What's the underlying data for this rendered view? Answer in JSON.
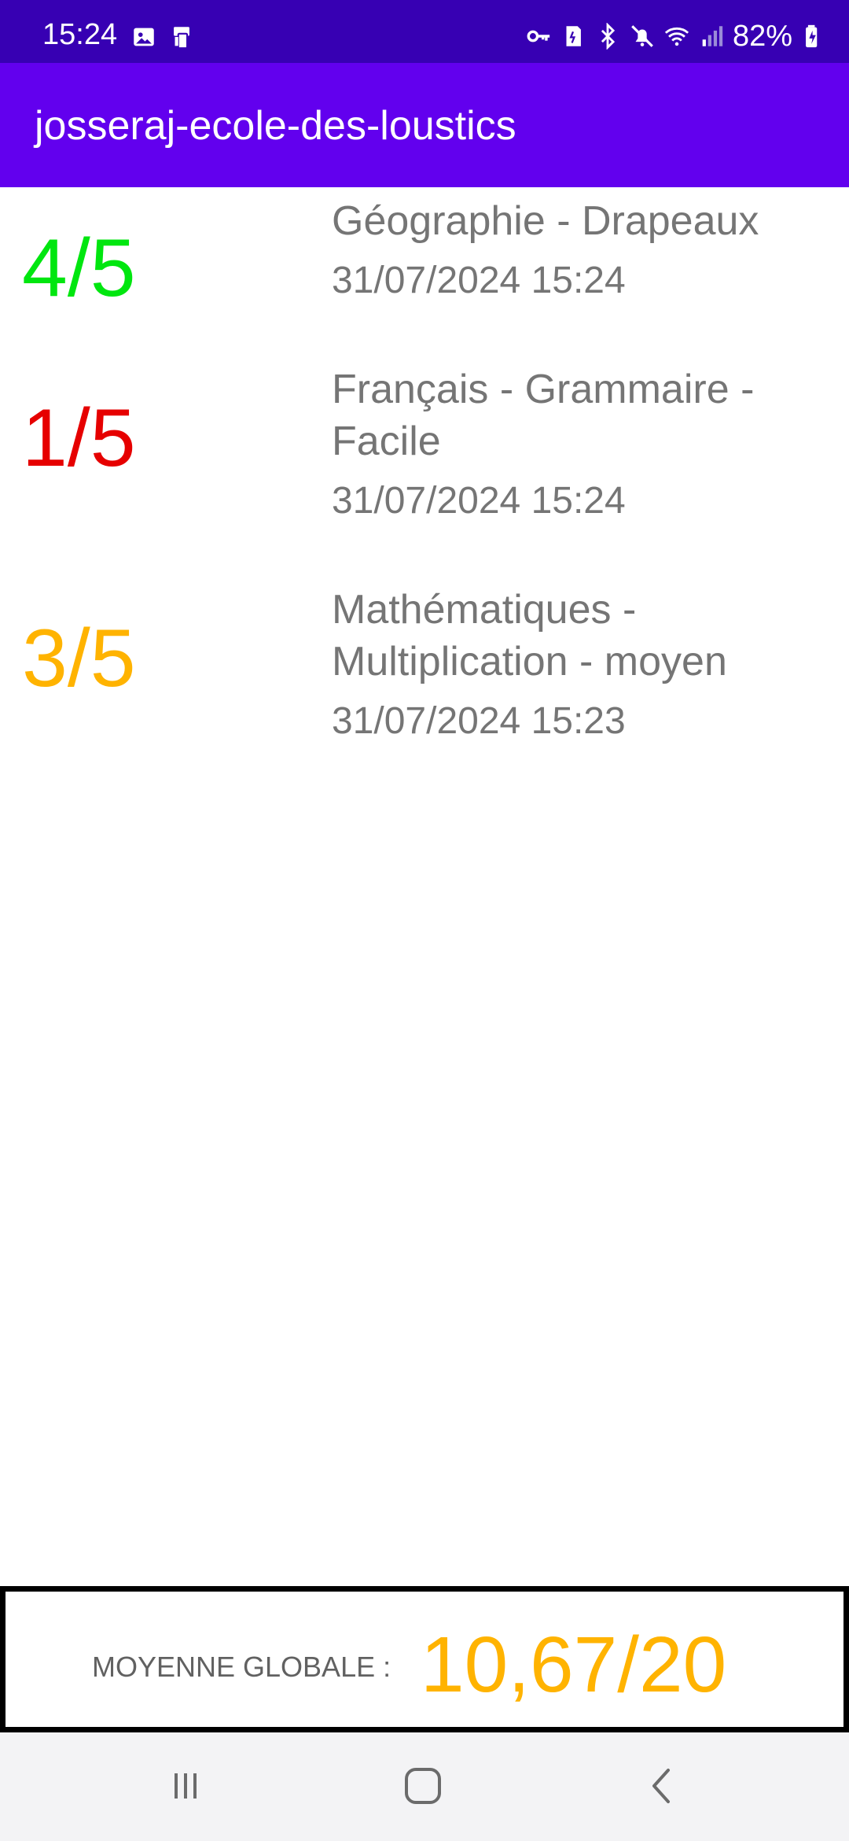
{
  "status_bar": {
    "time": "15:24",
    "battery": "82%",
    "left_icons": [
      "gallery-icon",
      "device-icon"
    ],
    "right_icons": [
      "key-icon",
      "sim-icon",
      "bluetooth-icon",
      "mute-icon",
      "wifi-icon",
      "signal-icon",
      "battery-icon"
    ]
  },
  "app_bar": {
    "title": "josseraj-ecole-des-loustics"
  },
  "results": [
    {
      "score": "4/5",
      "subject": "Géographie - Drapeaux",
      "date": "31/07/2024 15:24",
      "color": "#00e60f"
    },
    {
      "score": "1/5",
      "subject": "Français - Grammaire - Facile",
      "date": "31/07/2024 15:24",
      "color": "#e60000"
    },
    {
      "score": "3/5",
      "subject": "Mathématiques - Multiplication - moyen",
      "date": "31/07/2024 15:23",
      "color": "#ffb300"
    }
  ],
  "footer": {
    "label": "MOYENNE GLOBALE :",
    "value": "10,67/20",
    "value_color": "#ffb300"
  },
  "nav_bar": {
    "buttons": [
      "recent-apps-icon",
      "home-icon",
      "back-icon"
    ]
  },
  "colors": {
    "status_bar_bg": "#3700b3",
    "app_bar_bg": "#6200ee"
  }
}
